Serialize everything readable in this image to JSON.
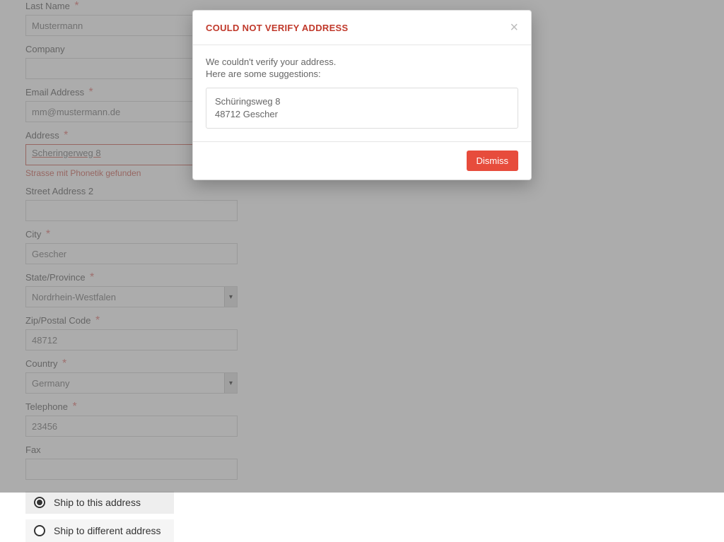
{
  "form": {
    "last_name": {
      "label": "Last Name",
      "required": true,
      "value": "Mustermann"
    },
    "company": {
      "label": "Company",
      "required": false,
      "value": ""
    },
    "email": {
      "label": "Email Address",
      "required": true,
      "value": "mm@mustermann.de"
    },
    "address": {
      "label": "Address",
      "required": true,
      "value": "Scheringerweg 8",
      "error": "Strasse mit Phonetik gefunden"
    },
    "street2": {
      "label": "Street Address 2",
      "required": false,
      "value": ""
    },
    "city": {
      "label": "City",
      "required": true,
      "value": "Gescher"
    },
    "state": {
      "label": "State/Province",
      "required": true,
      "value": "Nordrhein-Westfalen"
    },
    "zip": {
      "label": "Zip/Postal Code",
      "required": true,
      "value": "48712"
    },
    "country": {
      "label": "Country",
      "required": true,
      "value": "Germany"
    },
    "telephone": {
      "label": "Telephone",
      "required": true,
      "value": "23456"
    },
    "fax": {
      "label": "Fax",
      "required": false,
      "value": ""
    }
  },
  "shipping": {
    "option_this": "Ship to this address",
    "option_different": "Ship to different address",
    "selected": "this"
  },
  "modal": {
    "title": "COULD NOT VERIFY ADDRESS",
    "line1": "We couldn't verify your address.",
    "line2": "Here are some suggestions:",
    "suggestion_line1": "Schüringsweg 8",
    "suggestion_line2": "48712 Gescher",
    "dismiss": "Dismiss"
  },
  "required_star": "*"
}
